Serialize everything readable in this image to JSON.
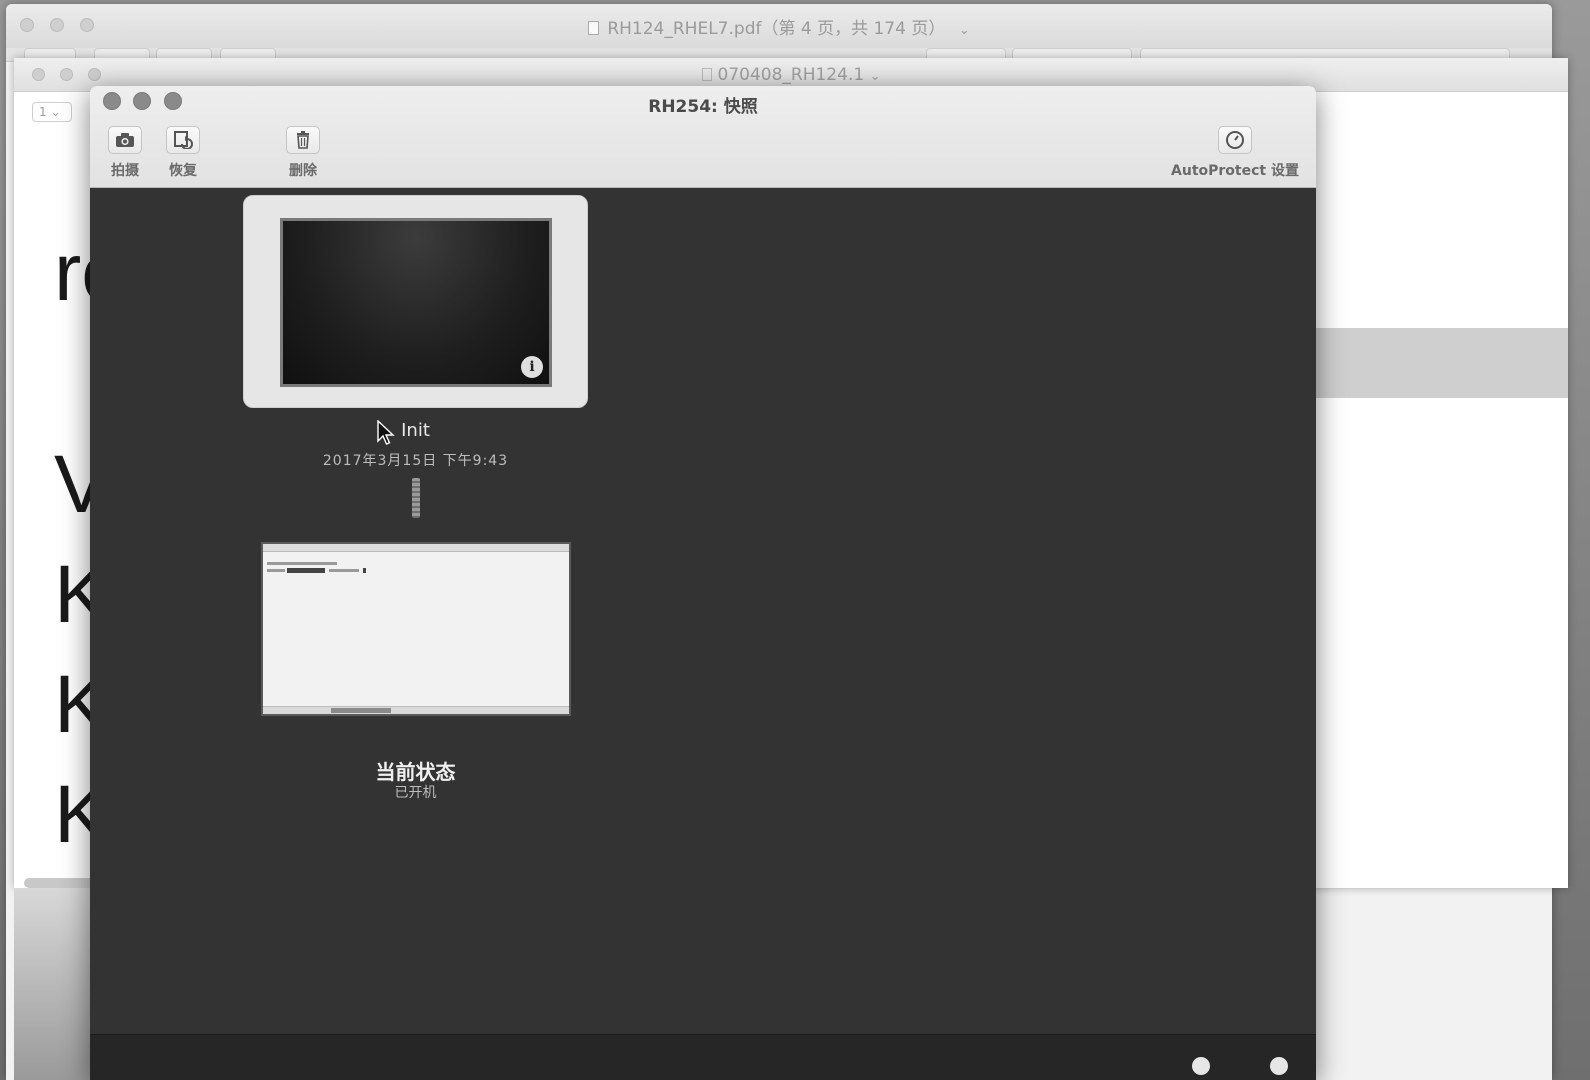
{
  "background_pdf": {
    "title": "RH124_RHEL7.pdf（第 4 页，共 174 页）",
    "title_chevron": "⌄"
  },
  "background_doc": {
    "title": "070408_RH124.1",
    "title_chevron": "⌄",
    "page_selector": "1 ⌄",
    "visible_text": [
      "ro",
      "V",
      "K",
      "K",
      "K"
    ]
  },
  "snapshot_window": {
    "title": "RH254: 快照",
    "toolbar": {
      "take_label": "拍摄",
      "restore_label": "恢复",
      "delete_label": "删除",
      "autoprotect_label": "AutoProtect 设置"
    },
    "snapshots": [
      {
        "name": "Init",
        "date": "2017年3月15日 下午9:43",
        "info_icon": "i"
      }
    ],
    "current_state": {
      "name": "当前状态",
      "status": "已开机"
    },
    "icons": {
      "take": "camera-icon",
      "restore": "restore-icon",
      "delete": "trash-icon",
      "autoprotect": "clock-icon"
    }
  }
}
